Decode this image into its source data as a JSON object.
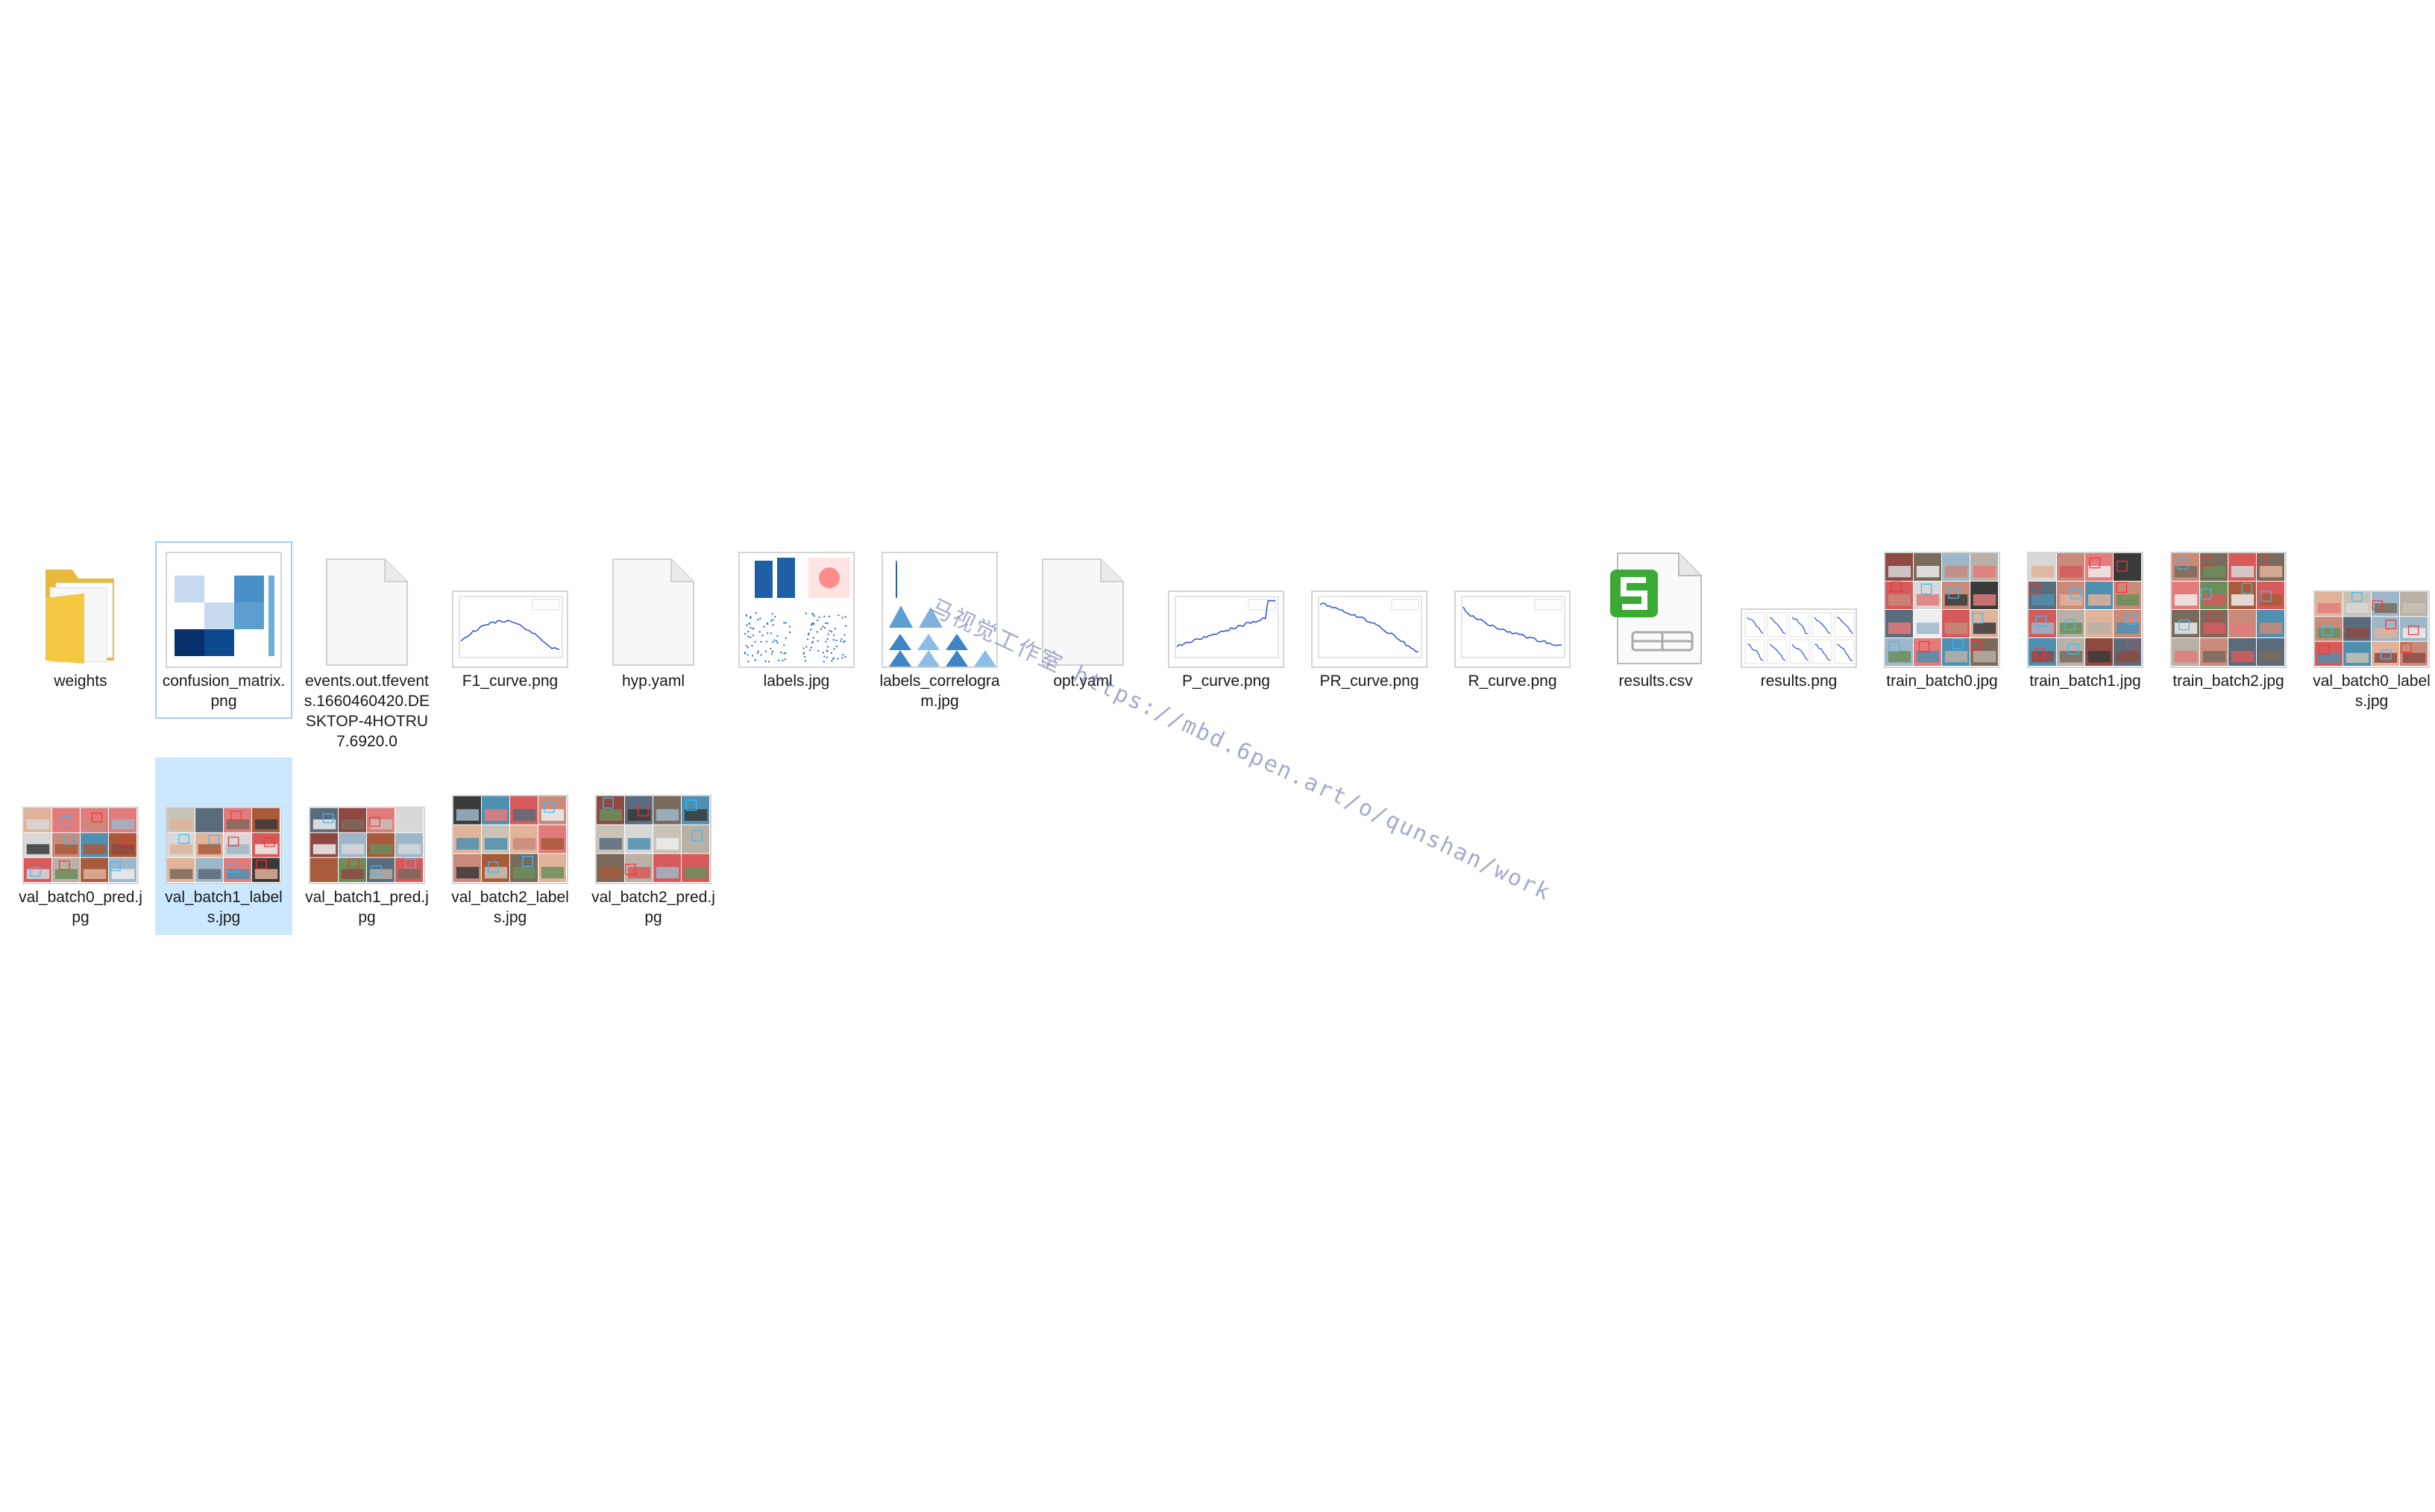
{
  "files": [
    {
      "name": "weights",
      "kind": "folder"
    },
    {
      "name": "confusion_matrix.png",
      "kind": "confusion",
      "state": "focus"
    },
    {
      "name": "events.out.tfevents.1660460420.DESKTOP-4HOTRU7.6920.0",
      "kind": "blank"
    },
    {
      "name": "F1_curve.png",
      "kind": "curve-f1"
    },
    {
      "name": "hyp.yaml",
      "kind": "blank"
    },
    {
      "name": "labels.jpg",
      "kind": "labels"
    },
    {
      "name": "labels_correlogram.jpg",
      "kind": "correlogram"
    },
    {
      "name": "opt.yaml",
      "kind": "blank"
    },
    {
      "name": "P_curve.png",
      "kind": "curve-p"
    },
    {
      "name": "PR_curve.png",
      "kind": "curve-pr"
    },
    {
      "name": "R_curve.png",
      "kind": "curve-r"
    },
    {
      "name": "results.csv",
      "kind": "csv"
    },
    {
      "name": "results.png",
      "kind": "results"
    },
    {
      "name": "train_batch0.jpg",
      "kind": "photo-square"
    },
    {
      "name": "train_batch1.jpg",
      "kind": "photo-square"
    },
    {
      "name": "train_batch2.jpg",
      "kind": "photo-square"
    },
    {
      "name": "val_batch0_labels.jpg",
      "kind": "photo-wide"
    },
    {
      "name": "val_batch0_pred.jpg",
      "kind": "photo-wide"
    },
    {
      "name": "val_batch1_labels.jpg",
      "kind": "photo-wide",
      "state": "selected"
    },
    {
      "name": "val_batch1_pred.jpg",
      "kind": "photo-wide"
    },
    {
      "name": "val_batch2_labels.jpg",
      "kind": "photo-mid"
    },
    {
      "name": "val_batch2_pred.jpg",
      "kind": "photo-mid"
    }
  ],
  "watermark": "马视觉工作室 https://mbd.6pen.art/o/qunshan/work",
  "colors": {
    "selection": "#cce8ff",
    "focus": "#99d1ff",
    "folder": "#f5c842",
    "csv_icon": "#3aaa35",
    "plot_line": "#3050d8",
    "blue_dark": "#1f5fa6"
  }
}
